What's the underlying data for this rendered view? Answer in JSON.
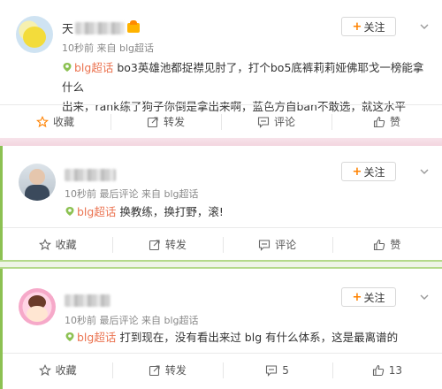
{
  "posts": [
    {
      "name_prefix": "天",
      "time": "10秒前",
      "source": "来自 blg超话",
      "follow_label": "关注",
      "topic": "blg超话",
      "text_line1": "bo3英雄池都捉襟见肘了，打个bo5底裤莉莉娅佛耶戈一榜能拿什么",
      "text_line2": "出来，rank练了狗子你倒是拿出来啊，蓝色方自ban不敢选，就这水平",
      "actions": {
        "collect": "收藏",
        "repost": "转发",
        "comment": "评论",
        "like": "赞"
      }
    },
    {
      "time": "10秒前",
      "meta_extra": "最后评论 来自 blg超话",
      "follow_label": "关注",
      "topic": "blg超话",
      "text": "换教练，换打野，滚!",
      "actions": {
        "collect": "收藏",
        "repost": "转发",
        "comment": "评论",
        "like": "赞"
      }
    },
    {
      "time": "10秒前",
      "meta_extra": "最后评论 来自 blg超话",
      "follow_label": "关注",
      "topic": "blg超话",
      "text": "打到现在，没有看出来过 blg 有什么体系，这是最离谱的",
      "actions": {
        "collect": "收藏",
        "repost": "转发",
        "comment": "5",
        "like": "13"
      }
    }
  ],
  "colors": {
    "accent": "#ff8200",
    "topic": "#eb7350",
    "green": "#8cc152"
  }
}
